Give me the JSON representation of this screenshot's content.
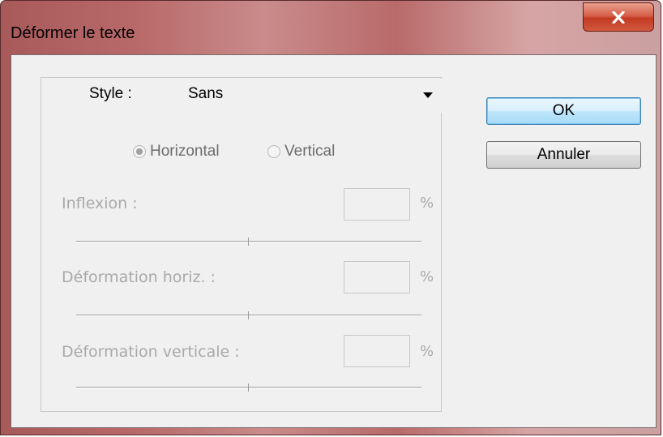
{
  "window": {
    "title": "Déformer le texte"
  },
  "style": {
    "label": "Style :",
    "value": "Sans"
  },
  "orientation": {
    "horizontal": "Horizontal",
    "vertical": "Vertical",
    "selected": "Horizontal"
  },
  "fields": [
    {
      "label": "Inflexion :",
      "value": "",
      "unit": "%"
    },
    {
      "label": "Déformation horiz. :",
      "value": "",
      "unit": "%"
    },
    {
      "label": "Déformation verticale :",
      "value": "",
      "unit": "%"
    }
  ],
  "buttons": {
    "ok": "OK",
    "cancel": "Annuler"
  },
  "icons": {
    "close": "close-icon",
    "dropdown": "chevron-down-icon"
  },
  "colors": {
    "titlebar": "#b86868",
    "close_button": "#c23a22",
    "client_bg": "#f0f0f0",
    "disabled_text": "#a9a9a9",
    "ok_border": "#3c7fb1"
  }
}
